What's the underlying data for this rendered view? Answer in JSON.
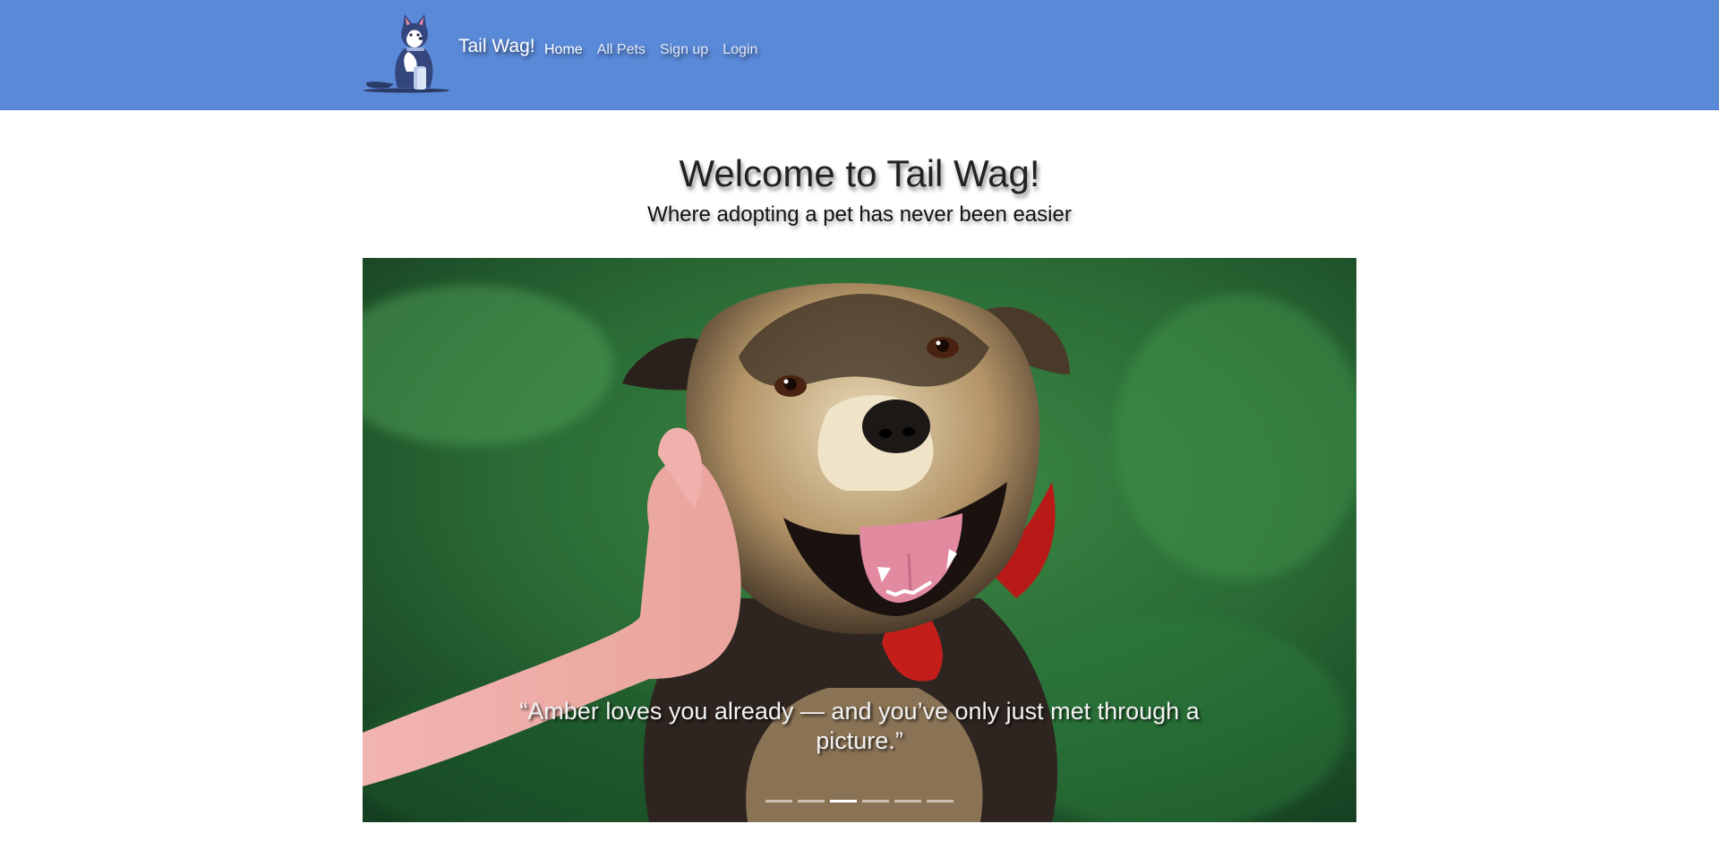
{
  "brand": {
    "name": "Tail Wag!",
    "logo_icon": "husky-dog-logo-icon"
  },
  "nav": {
    "items": [
      {
        "label": "Home",
        "active": true
      },
      {
        "label": "All Pets",
        "active": false
      },
      {
        "label": "Sign up",
        "active": false
      },
      {
        "label": "Login",
        "active": false
      }
    ]
  },
  "hero": {
    "title": "Welcome to Tail Wag!",
    "subtitle": "Where adopting a pet has never been easier"
  },
  "carousel": {
    "caption": "“Amber loves you already — and you’ve only just met through a picture.”",
    "slide_count": 6,
    "active_index": 2
  },
  "colors": {
    "navbar": "#5a89d8",
    "text_dark": "#222222",
    "caption": "#f3f3f3"
  }
}
